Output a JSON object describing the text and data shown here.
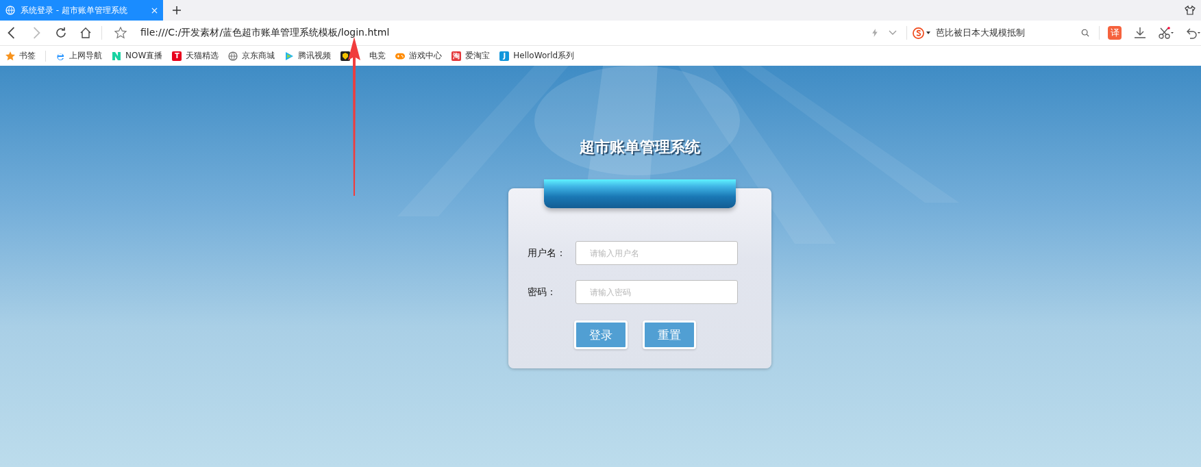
{
  "browser": {
    "tabs": [
      {
        "title": "系统登录 - 超市账单管理系统",
        "selected": true
      }
    ],
    "address": "file:///C:/开发素材/蓝色超市账单管理系统模板/login.html",
    "search": "芭比被日本大规模抵制",
    "translate": "译",
    "bookmarks": [
      {
        "kind": "star",
        "label": "书签"
      },
      {
        "kind": "ie",
        "label": "上网导航"
      },
      {
        "kind": "now",
        "label": "NOW直播"
      },
      {
        "kind": "letter",
        "badge": "T",
        "color": "#e8001c",
        "label": "天猫精选"
      },
      {
        "kind": "globe",
        "label": "京东商城"
      },
      {
        "kind": "play",
        "label": "腾讯视频"
      },
      {
        "kind": "shield",
        "label": "电竞"
      },
      {
        "kind": "gamepad",
        "label": "游戏中心"
      },
      {
        "kind": "letter",
        "badge": "淘",
        "color": "#e4393c",
        "label": "爱淘宝"
      },
      {
        "kind": "letter",
        "badge": "J",
        "color": "#1296db",
        "label": "HelloWorld系列"
      }
    ]
  },
  "page": {
    "title": "超市账单管理系统",
    "fields": [
      {
        "label": "用户名：",
        "placeholder": "请输入用户名"
      },
      {
        "label": "密码：",
        "placeholder": "请输入密码"
      }
    ],
    "buttons": [
      {
        "label": "登录"
      },
      {
        "label": "重置"
      }
    ]
  }
}
